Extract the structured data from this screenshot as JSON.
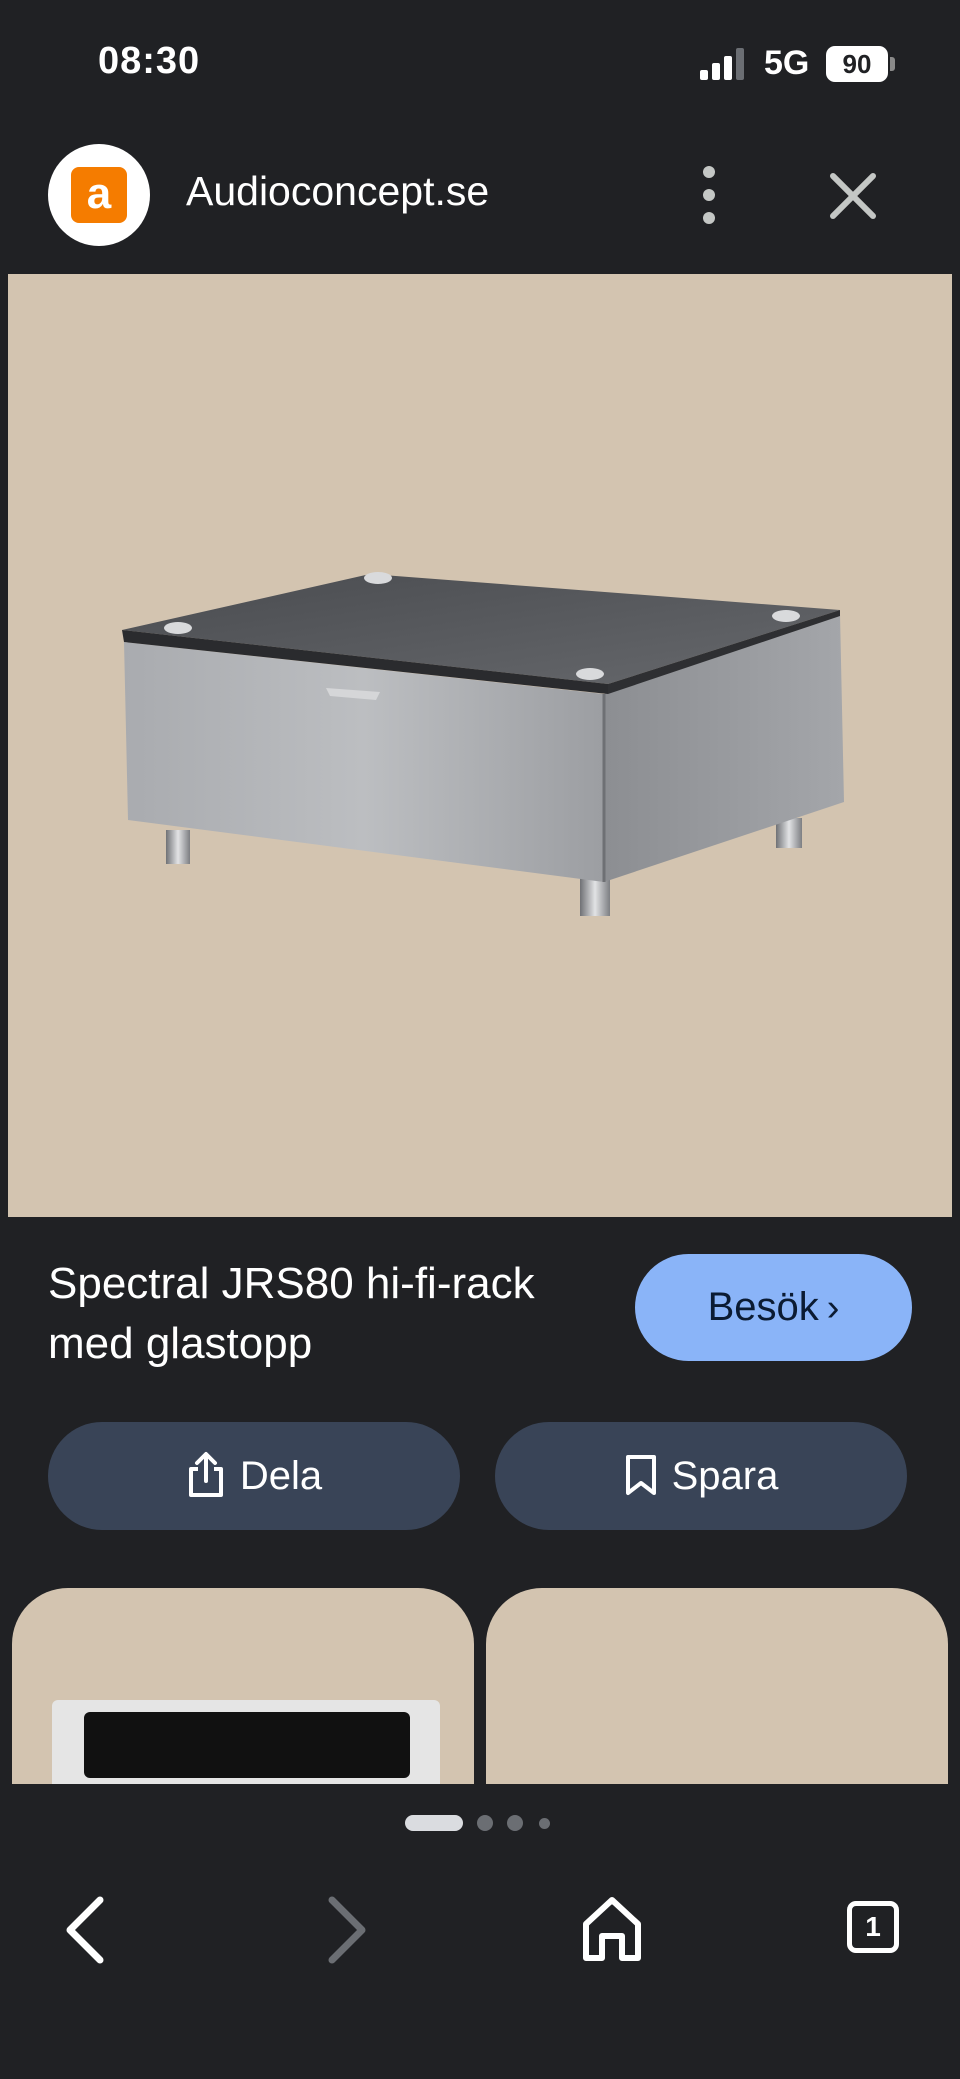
{
  "status_bar": {
    "time": "08:30",
    "network": "5G",
    "battery": "90"
  },
  "header": {
    "site_logo_letter": "a",
    "site_name": "Audioconcept.se",
    "logo_color": "#f57c00"
  },
  "result": {
    "title": "Spectral JRS80 hi-fi-rack med glastopp",
    "visit_label": "Besök",
    "visit_chevron": "›",
    "share_label": "Dela",
    "save_label": "Spara"
  },
  "pager": {
    "total": 4,
    "active_index": 0
  },
  "tabs": {
    "count": "1"
  },
  "colors": {
    "background": "#202124",
    "accent": "#8ab4f8",
    "action_button": "#394457",
    "image_backdrop": "#d3c4b0"
  },
  "icons": {
    "more": "more-vert-icon",
    "close": "close-icon",
    "share": "share-icon",
    "save": "bookmark-icon",
    "back": "back-icon",
    "forward": "forward-icon",
    "home": "home-icon",
    "tabs": "tabs-icon"
  }
}
